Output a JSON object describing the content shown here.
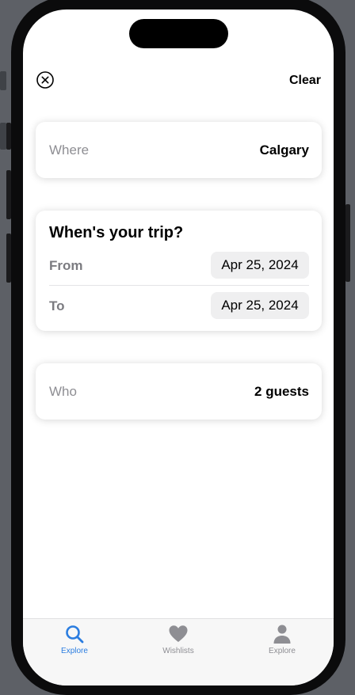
{
  "header": {
    "close_icon": "circle-x-icon",
    "clear_label": "Clear"
  },
  "where": {
    "label": "Where",
    "value": "Calgary"
  },
  "trip": {
    "title": "When's your trip?",
    "from_label": "From",
    "from_value": "Apr 25, 2024",
    "to_label": "To",
    "to_value": "Apr 25, 2024"
  },
  "who": {
    "label": "Who",
    "value": "2 guests"
  },
  "tabs": [
    {
      "label": "Explore",
      "icon": "magnifying-glass-icon",
      "active": true
    },
    {
      "label": "Wishlists",
      "icon": "heart-icon",
      "active": false
    },
    {
      "label": "Explore",
      "icon": "person-icon",
      "active": false
    }
  ],
  "colors": {
    "accent": "#2b7de0",
    "inactive_tab": "#8e8e93",
    "secondary_text": "#8e8e93",
    "pill_background": "#efeff0"
  }
}
